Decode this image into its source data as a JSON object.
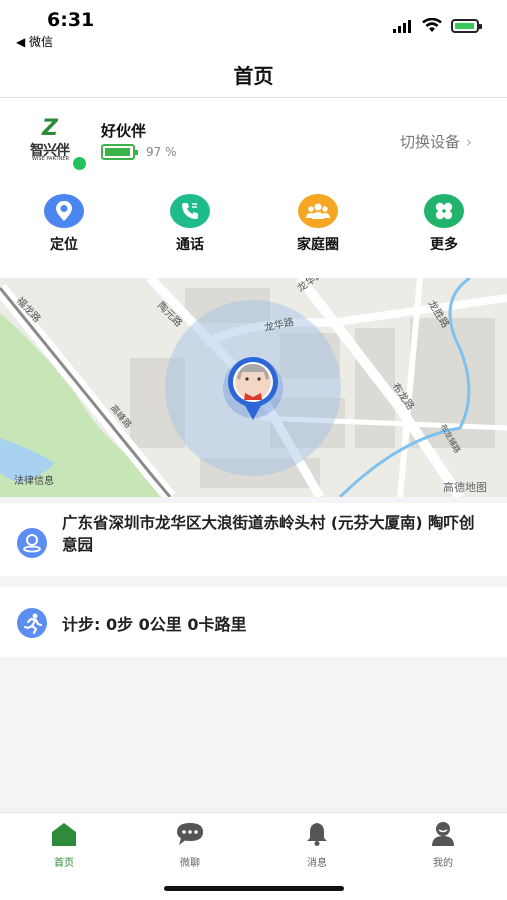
{
  "status": {
    "time": "6:31",
    "back_label": "◀ 微信"
  },
  "nav": {
    "title": "首页"
  },
  "device": {
    "brand_logo_text": "智兴伴",
    "brand_logo_sub": "WISE PARTNER",
    "name": "好伙伴",
    "battery_pct": "97 %",
    "battery_level": 0.97,
    "switch_label": "切换设备",
    "online": true
  },
  "quick_actions": [
    {
      "label": "定位",
      "icon": "location-pin-icon",
      "color": "#4a85f0"
    },
    {
      "label": "通话",
      "icon": "phone-icon",
      "color": "#1ebc8c"
    },
    {
      "label": "家庭圈",
      "icon": "family-icon",
      "color": "#f5a623"
    },
    {
      "label": "更多",
      "icon": "clover-icon",
      "color": "#21b26b"
    }
  ],
  "map": {
    "roads": [
      "陶元路",
      "龙华路",
      "布龙路",
      "龙胜路",
      "福龙路",
      "布龙辅路",
      "高峰路"
    ],
    "legal_label": "法律信息",
    "provider_label": "高德地图"
  },
  "address": {
    "text": "广东省深圳市龙华区大浪街道赤岭头村 (元芬大厦南) 陶吓创意园"
  },
  "steps": {
    "text": "计步: 0步 0公里 0卡路里"
  },
  "tabs": [
    {
      "label": "首页",
      "icon": "home-icon",
      "active": true
    },
    {
      "label": "微聊",
      "icon": "chat-icon",
      "active": false
    },
    {
      "label": "消息",
      "icon": "bell-icon",
      "active": false
    },
    {
      "label": "我的",
      "icon": "user-icon",
      "active": false
    }
  ],
  "colors": {
    "accent_green": "#2e8b3a",
    "accent_blue": "#5b8ef0"
  }
}
